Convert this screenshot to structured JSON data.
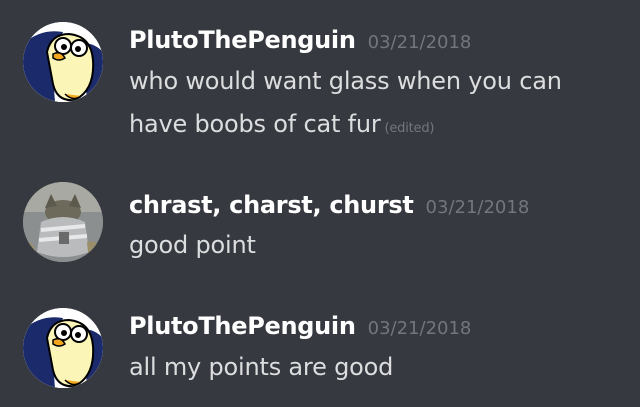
{
  "messages": [
    {
      "username": "PlutoThePenguin",
      "timestamp": "03/21/2018",
      "lines": [
        "who would want glass when you can",
        "have boobs of cat fur"
      ],
      "edited_label": "(edited)",
      "avatar_icon": "penguin-avatar-icon"
    },
    {
      "username": "chrast, charst, churst",
      "timestamp": "03/21/2018",
      "lines": [
        "good point"
      ],
      "avatar_icon": "cat-photo-avatar-icon"
    },
    {
      "username": "PlutoThePenguin",
      "timestamp": "03/21/2018",
      "lines": [
        "all my points are good"
      ],
      "avatar_icon": "penguin-avatar-icon"
    }
  ],
  "colors": {
    "background": "#36393f",
    "username": "#ffffff",
    "text": "#dcddde",
    "muted": "#72767d"
  }
}
